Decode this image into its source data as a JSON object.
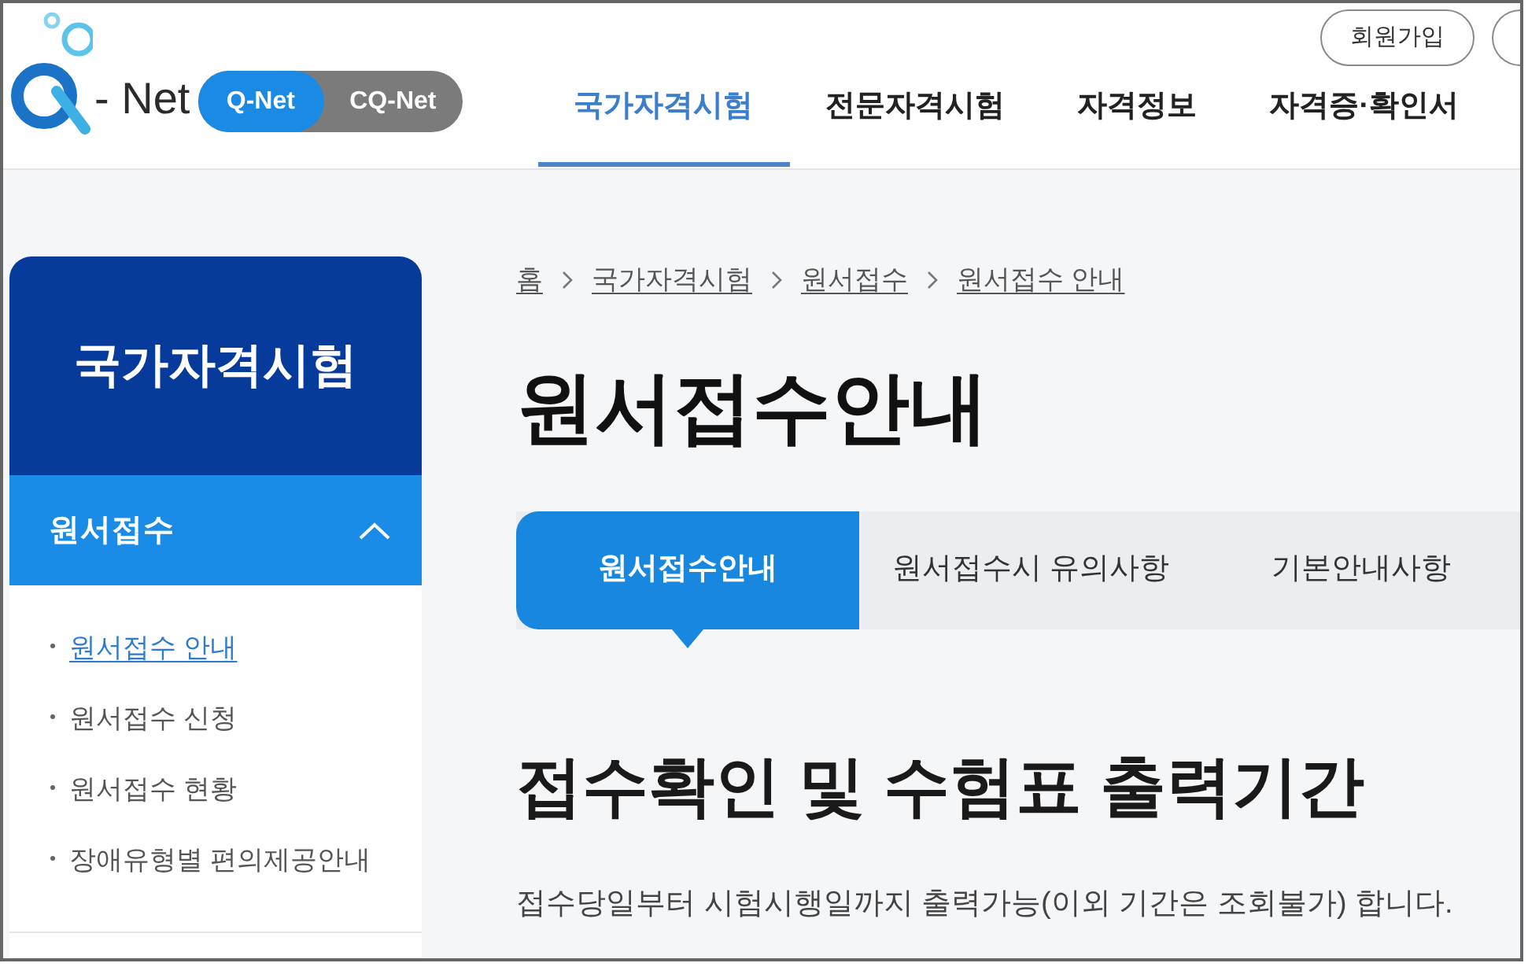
{
  "header": {
    "logo": {
      "text": "- Net"
    },
    "site_switch": [
      {
        "label": "Q-Net",
        "selected": true
      },
      {
        "label": "CQ-Net",
        "selected": false
      }
    ],
    "utility_links": [
      {
        "label": "회원가입"
      }
    ],
    "nav": [
      {
        "label": "국가자격시험",
        "selected": true
      },
      {
        "label": "전문자격시험",
        "selected": false
      },
      {
        "label": "자격정보",
        "selected": false
      },
      {
        "label": "자격증·확인서",
        "selected": false
      }
    ]
  },
  "sidebar": {
    "title": "국가자격시험",
    "section": {
      "label": "원서접수",
      "expanded": true,
      "items": [
        {
          "label": "원서접수 안내",
          "selected": true
        },
        {
          "label": "원서접수 신청",
          "selected": false
        },
        {
          "label": "원서접수 현황",
          "selected": false
        },
        {
          "label": "장애유형별 편의제공안내",
          "selected": false
        }
      ]
    }
  },
  "breadcrumb": [
    "홈",
    "국가자격시험",
    "원서접수",
    "원서접수 안내"
  ],
  "page_title": "원서접수안내",
  "tabs": [
    {
      "label": "원서접수안내",
      "selected": true
    },
    {
      "label": "원서접수시 유의사항",
      "selected": false
    },
    {
      "label": "기본안내사항",
      "selected": false
    }
  ],
  "section": {
    "heading": "접수확인 및 수험표 출력기간",
    "paragraph": "접수당일부터 시험시행일까지 출력가능(이외 기간은 조회불가) 합니다."
  }
}
